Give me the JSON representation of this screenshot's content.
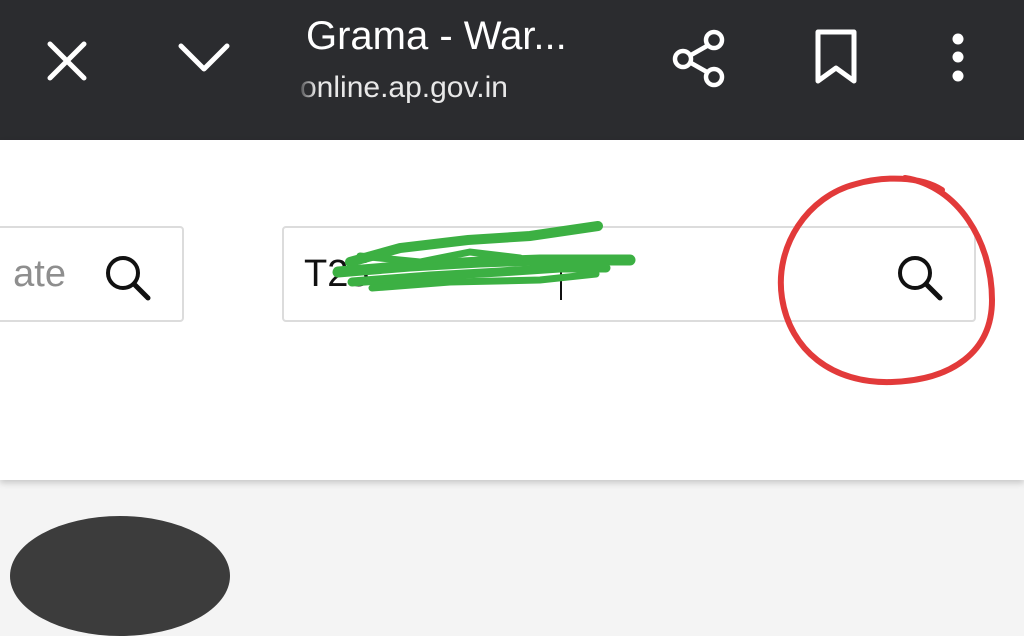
{
  "browser": {
    "title": "Grama - War...",
    "url": "online.ap.gov.in",
    "icons": [
      "close-icon",
      "chevron-down-icon",
      "share-icon",
      "bookmark-icon",
      "more-vert-icon"
    ],
    "bar_color": "#2b2c2f"
  },
  "search_left": {
    "placeholder_fragment": "ate",
    "icon": "search-icon"
  },
  "search_right": {
    "value": "T25",
    "icon": "search-icon"
  },
  "annotations": {
    "scribble_color": "#3cb043",
    "circle_color": "#e23a3a"
  }
}
